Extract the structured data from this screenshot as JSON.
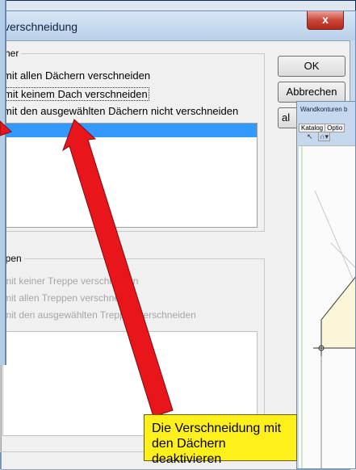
{
  "dialog": {
    "title": "verschneidung",
    "close_symbol": "x",
    "buttons": {
      "ok": "OK",
      "cancel": "Abbrechen",
      "third_partial": "al"
    }
  },
  "roof_group": {
    "title": "cher",
    "options": [
      {
        "label": "mit allen Dächern verschneiden",
        "selected": false
      },
      {
        "label": "mit keinem Dach verschneiden",
        "selected": true
      },
      {
        "label": "mit den ausgewählten Dächern nicht verschneiden",
        "selected": false
      }
    ]
  },
  "stairs_group": {
    "title": "ppen",
    "options": [
      {
        "label": "mit keiner Treppe verschneiden"
      },
      {
        "label": "mit allen Treppen verschneiden"
      },
      {
        "label": "mit den ausgewählten Treppen verschneiden"
      }
    ]
  },
  "window2": {
    "title": "Wandkonturen b",
    "tabs": [
      "Katalog",
      "Optio"
    ]
  },
  "callout": {
    "line1": "Die Verschneidung mit",
    "line2": "den Dächern deaktivieren"
  },
  "colors": {
    "arrow": "#e8151b",
    "callout": "#ffef1a",
    "selection": "#3399ff"
  }
}
